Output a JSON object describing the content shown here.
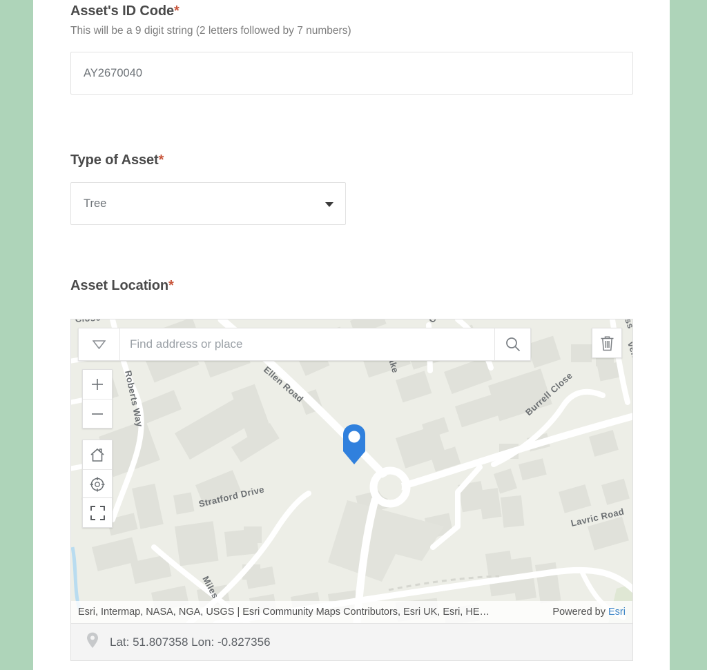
{
  "theme": {
    "page_background": "#aed4b9",
    "panel_background": "#ffffff",
    "required_star_color": "#c8553b",
    "marker_color": "#3080dd",
    "link_color": "#3e86c8",
    "map_background": "#edeee7"
  },
  "form": {
    "asset_id": {
      "label": "Asset's ID Code",
      "required_marker": "*",
      "hint": "This will be a 9 digit string (2 letters followed by 7 numbers)",
      "value": "AY2670040",
      "placeholder": ""
    },
    "asset_type": {
      "label": "Type of Asset",
      "required_marker": "*",
      "selected": "Tree",
      "options": [
        "Tree"
      ]
    },
    "asset_location": {
      "label": "Asset Location",
      "required_marker": "*"
    }
  },
  "map": {
    "search": {
      "placeholder": "Find address or place",
      "value": "",
      "toggle_icon": "chevron-down-icon",
      "submit_icon": "search-icon"
    },
    "controls": {
      "zoom_in": "+",
      "zoom_out": "−",
      "home_icon": "home-icon",
      "locate_icon": "locate-crosshair-icon",
      "fullscreen_icon": "fullscreen-icon",
      "delete_icon": "trash-icon"
    },
    "marker": {
      "icon": "map-pin-marker",
      "color": "#3080dd"
    },
    "attribution": {
      "text": "Esri, Intermap, NASA, NGA, USGS | Esri Community Maps Contributors, Esri UK, Esri, HE…",
      "powered_by_prefix": "Powered by",
      "powered_by_link": "Esri"
    },
    "coordinates": {
      "icon": "location-pin-icon",
      "text": "Lat: 51.807358  Lon: -0.827356",
      "lat": "51.807358",
      "lon": "-0.827356"
    },
    "road_labels": [
      "Close",
      "oad",
      "Ellen Road",
      "Drake",
      "Roberts Way",
      "Stratford Drive",
      "Miles",
      "Burrell Close",
      "Clo",
      "Lavric Road",
      "ss",
      "ven"
    ]
  }
}
